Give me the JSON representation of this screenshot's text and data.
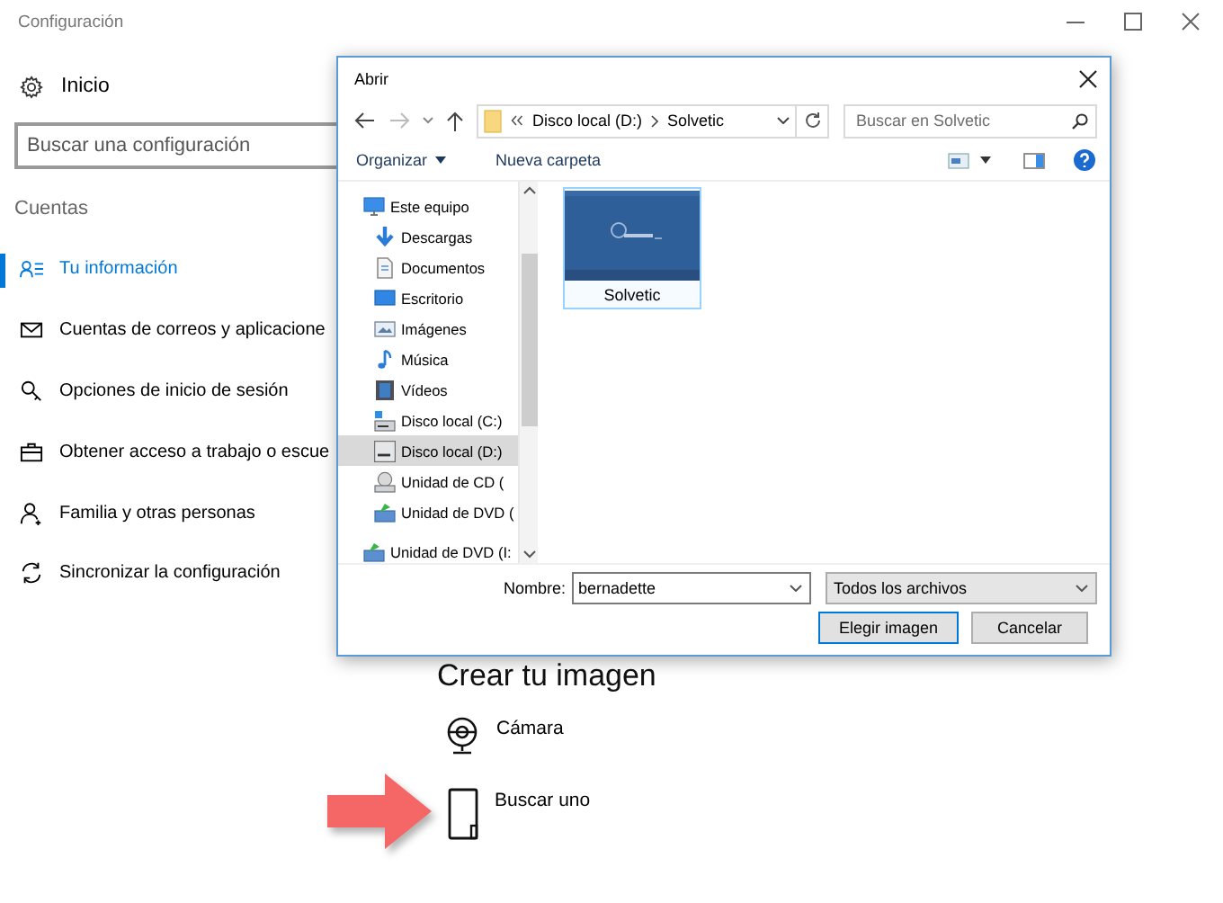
{
  "window": {
    "title": "Configuración"
  },
  "sidebar": {
    "home": "Inicio",
    "search": {
      "placeholder": "Buscar una configuración"
    },
    "section": "Cuentas",
    "items": [
      {
        "label": "Tu información",
        "kind": "account",
        "selected": true
      },
      {
        "label": "Cuentas de correos y aplicacione",
        "kind": "mail",
        "selected": false
      },
      {
        "label": "Opciones de inicio de sesión",
        "kind": "key",
        "selected": false
      },
      {
        "label": "Obtener acceso a trabajo o escue",
        "kind": "work",
        "selected": false
      },
      {
        "label": "Familia y otras personas",
        "kind": "family",
        "selected": false
      },
      {
        "label": "Sincronizar la configuración",
        "kind": "sync",
        "selected": false
      }
    ]
  },
  "content": {
    "heading": "Crear tu imagen",
    "options": [
      {
        "label": "Cámara",
        "kind": "camera"
      },
      {
        "label": "Buscar uno",
        "kind": "browse"
      }
    ]
  },
  "dialog": {
    "title": "Abrir",
    "address": [
      "Disco local (D:)",
      "Solvetic"
    ],
    "search": {
      "placeholder": "Buscar en Solvetic"
    },
    "toolbar": {
      "organize": "Organizar",
      "new_folder": "Nueva carpeta"
    },
    "tree": [
      {
        "label": "Este equipo",
        "kind": "pc",
        "selected": false,
        "children": [
          {
            "label": "Descargas",
            "kind": "downloads",
            "selected": false
          },
          {
            "label": "Documentos",
            "kind": "documents",
            "selected": false
          },
          {
            "label": "Escritorio",
            "kind": "desktop",
            "selected": false
          },
          {
            "label": "Imágenes",
            "kind": "pictures",
            "selected": false
          },
          {
            "label": "Música",
            "kind": "music",
            "selected": false
          },
          {
            "label": "Vídeos",
            "kind": "videos",
            "selected": false
          },
          {
            "label": "Disco local (C:)",
            "kind": "system_drive",
            "selected": false
          },
          {
            "label": "Disco local (D:)",
            "kind": "drive",
            "selected": true
          },
          {
            "label": "Unidad de CD (",
            "kind": "cd",
            "selected": false
          },
          {
            "label": "Unidad de DVD (",
            "kind": "dvd",
            "selected": false
          }
        ]
      },
      {
        "label": "Unidad de DVD (I:",
        "kind": "dvd",
        "selected": false
      }
    ],
    "files": [
      {
        "name": "Solvetic",
        "selected": true
      }
    ],
    "filename": {
      "label": "Nombre:",
      "value": "bernadette"
    },
    "filter": "Todos los archivos",
    "buttons": [
      {
        "label": "Elegir imagen",
        "default": true
      },
      {
        "label": "Cancelar",
        "default": false
      }
    ]
  }
}
